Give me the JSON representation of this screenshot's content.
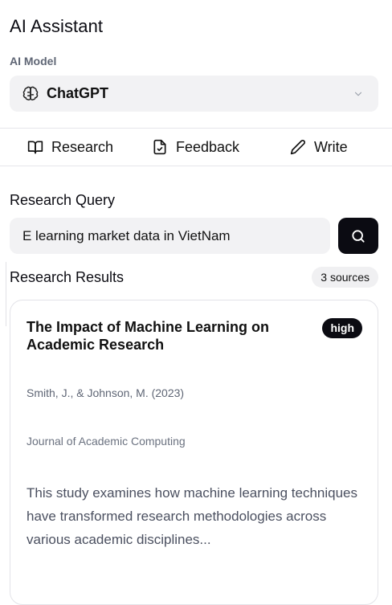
{
  "app": {
    "title": "AI Assistant"
  },
  "model": {
    "label": "AI Model",
    "selected": "ChatGPT"
  },
  "tabs": [
    {
      "label": "Research",
      "icon": "book-open-icon"
    },
    {
      "label": "Feedback",
      "icon": "file-check-icon"
    },
    {
      "label": "Write",
      "icon": "pencil-icon"
    }
  ],
  "research": {
    "query_label": "Research Query",
    "query_value": "E learning market data in VietNam",
    "results_label": "Research Results",
    "sources_count": "3 sources"
  },
  "results": [
    {
      "title": "The Impact of Machine Learning on Academic Research",
      "relevance": "high",
      "authors": "Smith, J., & Johnson, M. (2023)",
      "journal": "Journal of Academic Computing",
      "abstract": "This study examines how machine learning techniques have transformed research methodologies across various academic disciplines..."
    }
  ],
  "colors": {
    "accent": "#0b0b12",
    "muted_bg": "#f2f2f4",
    "muted_text": "#5f6675"
  }
}
